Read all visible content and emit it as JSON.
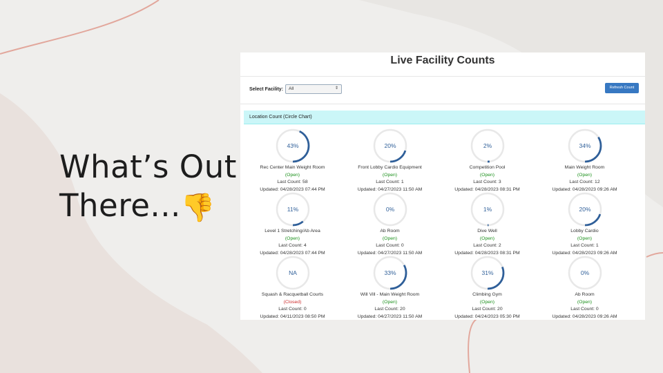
{
  "slide": {
    "title_line1": "What’s Out",
    "title_line2": "There...",
    "emoji": "👎"
  },
  "app": {
    "title": "Live Facility Counts",
    "select_label": "Select Facility:",
    "select_value": "All",
    "refresh_label": "Refresh Count",
    "panel_title": "Location Count (Circle Chart)",
    "colors": {
      "ring_fill": "#2f5f99",
      "ring_track": "#e8e8e8",
      "button": "#3778c2",
      "panel": "#cbf6f8"
    }
  },
  "locations": [
    {
      "name": "Rec Center Main Weight Room",
      "pct_label": "43%",
      "fraction": 0.43,
      "status": "(Open)",
      "open": true,
      "count": "Last Count: 58",
      "updated": "Updated: 04/28/2023 07:44 PM"
    },
    {
      "name": "Front Lobby Cardio Equipment",
      "pct_label": "20%",
      "fraction": 0.2,
      "status": "(Open)",
      "open": true,
      "count": "Last Count: 1",
      "updated": "Updated: 04/27/2023 11:50 AM"
    },
    {
      "name": "Competition Pool",
      "pct_label": "2%",
      "fraction": 0.02,
      "status": "(Open)",
      "open": true,
      "count": "Last Count: 3",
      "updated": "Updated: 04/28/2023 08:31 PM"
    },
    {
      "name": "Main Weight Room",
      "pct_label": "34%",
      "fraction": 0.34,
      "status": "(Open)",
      "open": true,
      "count": "Last Count: 12",
      "updated": "Updated: 04/28/2023 09:26 AM"
    },
    {
      "name": "Level 1 Stretching/Ab Area",
      "pct_label": "11%",
      "fraction": 0.11,
      "status": "(Open)",
      "open": true,
      "count": "Last Count: 4",
      "updated": "Updated: 04/28/2023 07:44 PM"
    },
    {
      "name": "Ab Room",
      "pct_label": "0%",
      "fraction": 0.0,
      "status": "(Open)",
      "open": true,
      "count": "Last Count: 0",
      "updated": "Updated: 04/27/2023 11:50 AM"
    },
    {
      "name": "Dive Well",
      "pct_label": "1%",
      "fraction": 0.01,
      "status": "(Open)",
      "open": true,
      "count": "Last Count: 2",
      "updated": "Updated: 04/28/2023 08:31 PM"
    },
    {
      "name": "Lobby Cardio",
      "pct_label": "20%",
      "fraction": 0.2,
      "status": "(Open)",
      "open": true,
      "count": "Last Count: 1",
      "updated": "Updated: 04/28/2023 09:26 AM"
    },
    {
      "name": "Squash & Racquetball Courts",
      "pct_label": "NA",
      "fraction": 0.0,
      "status": "(Closed)",
      "open": false,
      "count": "Last Count: 0",
      "updated": "Updated: 04/11/2023 08:50 PM"
    },
    {
      "name": "Will Vill - Main Weight Room",
      "pct_label": "33%",
      "fraction": 0.33,
      "status": "(Open)",
      "open": true,
      "count": "Last Count: 20",
      "updated": "Updated: 04/27/2023 11:50 AM"
    },
    {
      "name": "Climbing Gym",
      "pct_label": "31%",
      "fraction": 0.31,
      "status": "(Open)",
      "open": true,
      "count": "Last Count: 20",
      "updated": "Updated: 04/24/2023 05:30 PM"
    },
    {
      "name": "Ab Room",
      "pct_label": "0%",
      "fraction": 0.0,
      "status": "(Open)",
      "open": true,
      "count": "Last Count: 0",
      "updated": "Updated: 04/28/2023 09:26 AM"
    }
  ]
}
